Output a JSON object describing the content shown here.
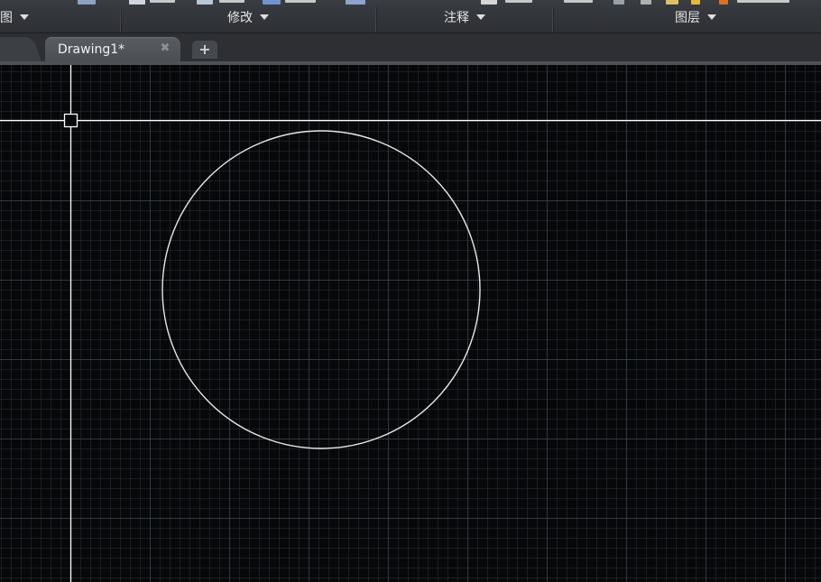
{
  "ribbon": {
    "panels": [
      {
        "label": "图"
      },
      {
        "label": "修改"
      },
      {
        "label": "注释"
      },
      {
        "label": "图层"
      }
    ]
  },
  "tabs": {
    "active": {
      "title": "Drawing1*"
    },
    "close_glyph": "✖",
    "new_glyph": "+"
  },
  "drawing": {
    "objects": [
      {
        "type": "circle",
        "stroke": "#e8e8e8"
      }
    ],
    "crosshair_color": "#ffffff",
    "background": "#070809"
  },
  "colors": {
    "ribbon_bg": "#35383c",
    "tab_active": "#53565b",
    "label_text": "#e6e6e6"
  }
}
